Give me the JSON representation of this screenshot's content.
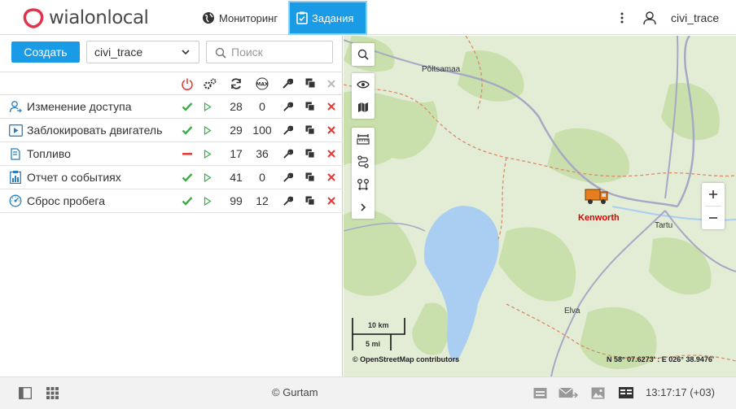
{
  "header": {
    "logo_text": "wialonlocal",
    "nav": {
      "monitoring": "Мониторинг",
      "tasks": "Задания"
    },
    "user_name": "civi_trace"
  },
  "toolbar": {
    "create_label": "Создать",
    "unit_select_value": "civi_trace",
    "search_placeholder": "Поиск"
  },
  "table": {
    "rows": [
      {
        "icon": "user-access-icon",
        "name": "Изменение доступа",
        "state": "enabled",
        "count": "28",
        "max": "0"
      },
      {
        "icon": "engine-block-icon",
        "name": "Заблокировать двигатель",
        "state": "enabled",
        "count": "29",
        "max": "100"
      },
      {
        "icon": "fuel-icon",
        "name": "Топливо",
        "state": "disabled",
        "count": "17",
        "max": "36"
      },
      {
        "icon": "report-icon",
        "name": "Отчет о событиях",
        "state": "enabled",
        "count": "41",
        "max": "0"
      },
      {
        "icon": "mileage-reset-icon",
        "name": "Сброс пробега",
        "state": "enabled",
        "count": "99",
        "max": "12"
      }
    ]
  },
  "map": {
    "unit_label": "Kenworth",
    "places": {
      "poltsamaa": "Põltsamaa",
      "tartu": "Tartu",
      "elva": "Elva"
    },
    "scale_km": "10 km",
    "scale_mi": "5 mi",
    "attribution": "© OpenStreetMap contributors",
    "coordinates": "N 58° 07.6273' : E 026° 38.9476'",
    "colors": {
      "water": "#aacdf2",
      "forest": "#cfe5b3",
      "road": "#a7a9c4",
      "border": "#d98b6a"
    }
  },
  "footer": {
    "copyright": "© Gurtam",
    "time": "13:17:17 (+03)"
  },
  "colors": {
    "accent": "#1a9be6",
    "enabled": "#3fae49",
    "disabled": "#e0403a",
    "delete": "#e53935"
  }
}
